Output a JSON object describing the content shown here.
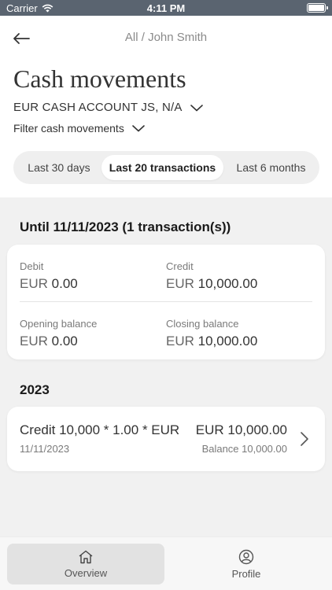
{
  "status_bar": {
    "carrier": "Carrier",
    "time": "4:11 PM"
  },
  "header": {
    "breadcrumb": "All / John Smith",
    "title": "Cash movements",
    "account": "EUR CASH ACCOUNT JS, N/A",
    "filter": "Filter cash movements"
  },
  "segments": [
    {
      "label": "Last 30 days",
      "selected": false
    },
    {
      "label": "Last 20 transactions",
      "selected": true
    },
    {
      "label": "Last 6 months",
      "selected": false
    }
  ],
  "summary": {
    "heading": "Until 11/11/2023 (1 transaction(s))",
    "debit": {
      "label": "Debit",
      "currency": "EUR",
      "amount": "0.00"
    },
    "credit": {
      "label": "Credit",
      "currency": "EUR",
      "amount": "10,000.00"
    },
    "opening": {
      "label": "Opening balance",
      "currency": "EUR",
      "amount": "0.00"
    },
    "closing": {
      "label": "Closing balance",
      "currency": "EUR",
      "amount": "10,000.00"
    }
  },
  "year_heading": "2023",
  "transactions": [
    {
      "description": "Credit 10,000 * 1.00 * EUR",
      "date": "11/11/2023",
      "amount": "EUR 10,000.00",
      "balance": "Balance 10,000.00"
    }
  ],
  "tabbar": [
    {
      "label": "Overview",
      "icon": "home-icon",
      "active": true
    },
    {
      "label": "Profile",
      "icon": "profile-icon",
      "active": false
    }
  ],
  "colors": {
    "status_bar": "#5a6470",
    "background": "#f1f1f1",
    "active_tab": "#e2e2e2"
  }
}
